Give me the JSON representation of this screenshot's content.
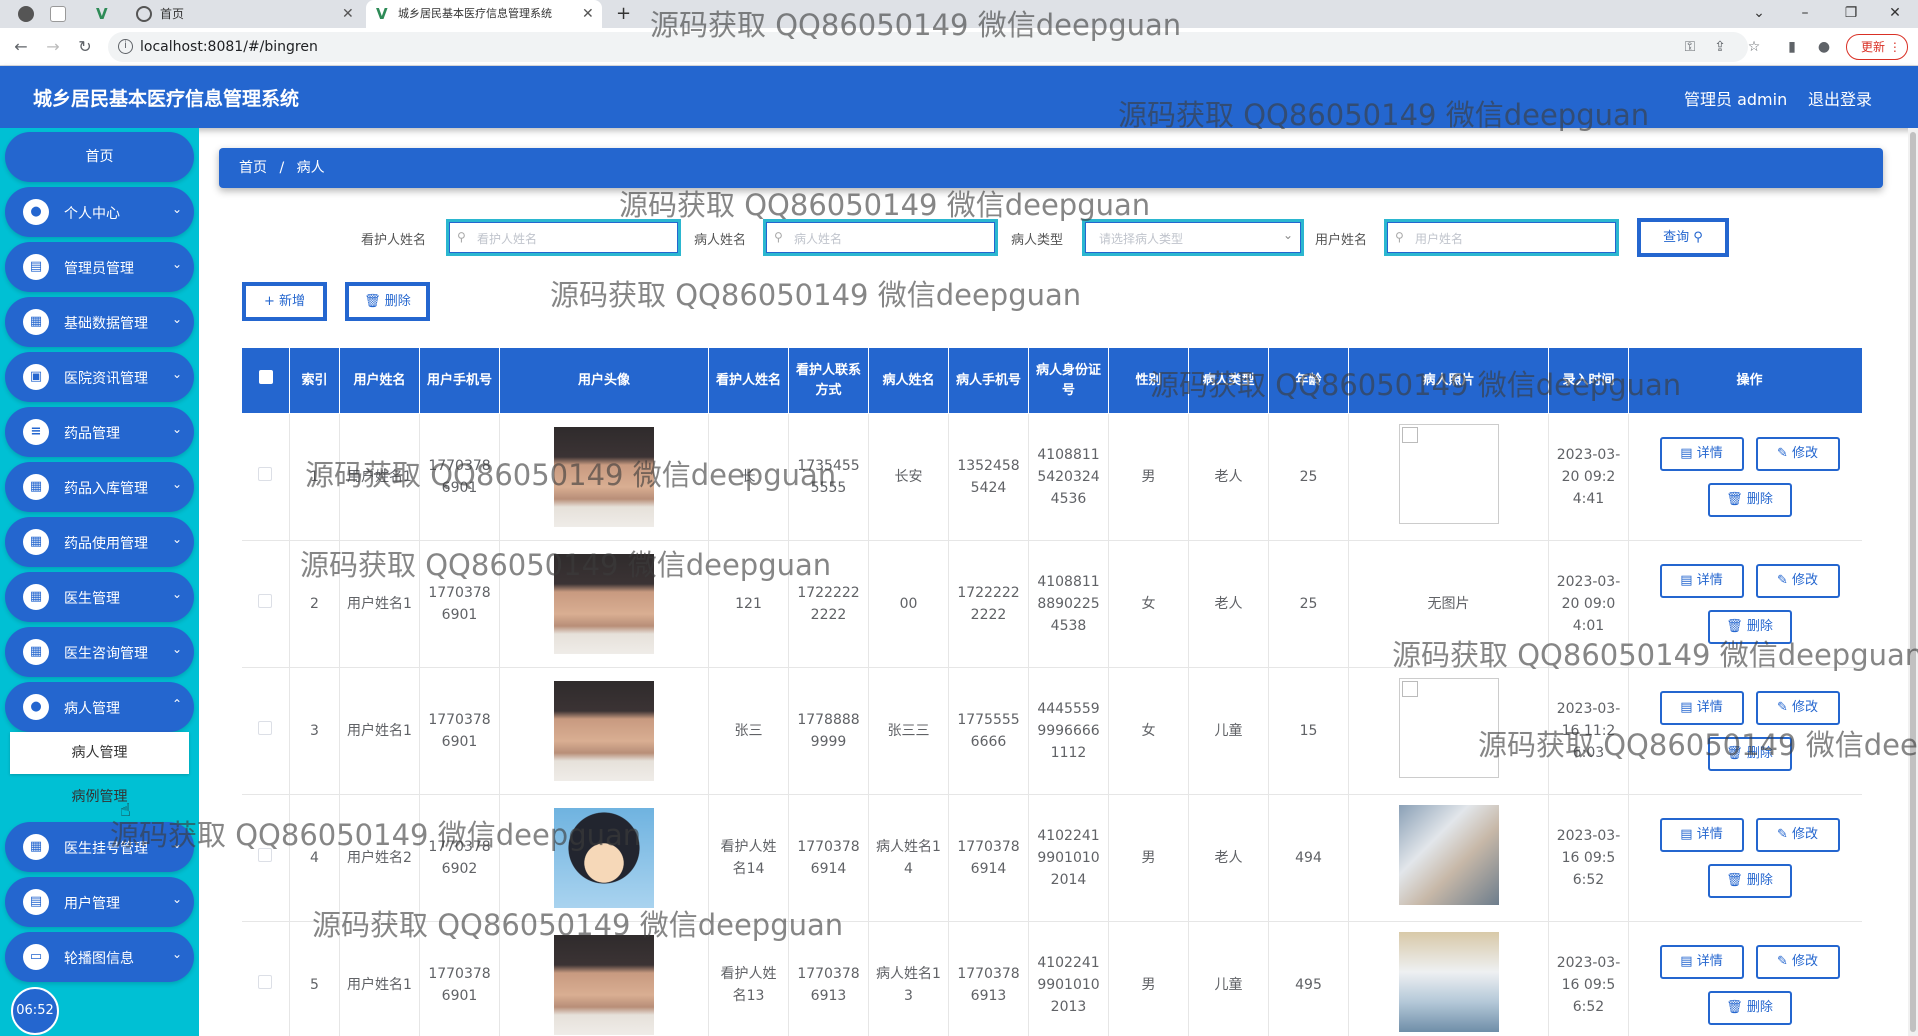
{
  "browser": {
    "tabs": [
      {
        "title": "首页"
      },
      {
        "title": "城乡居民基本医疗信息管理系统"
      }
    ],
    "new_tab": "+",
    "url": "localhost:8081/#/bingren",
    "update_label": "更新"
  },
  "header": {
    "title": "城乡居民基本医疗信息管理系统",
    "admin": "管理员 admin",
    "logout": "退出登录"
  },
  "sidebar": {
    "home": "首页",
    "items": [
      {
        "label": "个人中心",
        "icon": "person-icon"
      },
      {
        "label": "管理员管理",
        "icon": "clipboard-icon"
      },
      {
        "label": "基础数据管理",
        "icon": "grid-icon"
      },
      {
        "label": "医院资讯管理",
        "icon": "news-icon"
      },
      {
        "label": "药品管理",
        "icon": "list-icon"
      },
      {
        "label": "药品入库管理",
        "icon": "grid-icon"
      },
      {
        "label": "药品使用管理",
        "icon": "grid-icon"
      },
      {
        "label": "医生管理",
        "icon": "grid-icon"
      },
      {
        "label": "医生咨询管理",
        "icon": "grid-icon"
      },
      {
        "label": "病人管理",
        "icon": "person-icon"
      }
    ],
    "sub_items": [
      "病人管理",
      "病例管理"
    ],
    "items_after": [
      {
        "label": "医生挂号管理",
        "icon": "grid-icon"
      },
      {
        "label": "用户管理",
        "icon": "clipboard-icon"
      },
      {
        "label": "轮播图信息",
        "icon": "carousel-icon"
      }
    ],
    "clock": "06:52"
  },
  "breadcrumb": {
    "home": "首页",
    "sep": "/",
    "current": "病人"
  },
  "search": {
    "fields": [
      {
        "label": "看护人姓名",
        "placeholder": "看护人姓名"
      },
      {
        "label": "病人姓名",
        "placeholder": "病人姓名"
      },
      {
        "label": "病人类型",
        "placeholder": "请选择病人类型"
      },
      {
        "label": "用户姓名",
        "placeholder": "用户姓名"
      }
    ],
    "query": "查询 ⚲"
  },
  "actions": {
    "add": "+ 新增",
    "delete": "🗑 删除"
  },
  "table": {
    "headers": [
      "索引",
      "用户姓名",
      "用户手机号",
      "用户头像",
      "看护人姓名",
      "看护人联系方式",
      "病人姓名",
      "病人手机号",
      "病人身份证号",
      "性别",
      "病人类型",
      "年龄",
      "病人照片",
      "录入时间",
      "操作"
    ],
    "rows": [
      {
        "index": "1",
        "user": "用户姓名1",
        "phone": "17703786901",
        "avatar": "boy",
        "guardian": "长",
        "guardian_phone": "17354555555",
        "patient": "长安",
        "patient_phone": "13524585424",
        "id_card": "410881154203244536",
        "sex": "男",
        "type": "老人",
        "age": "25",
        "photo": "broken",
        "time": "2023-03-20 09:24:41"
      },
      {
        "index": "2",
        "user": "用户姓名1",
        "phone": "17703786901",
        "avatar": "boy",
        "guardian": "121",
        "guardian_phone": "17222222222",
        "patient": "00",
        "patient_phone": "17222222222",
        "id_card": "410881188902254538",
        "sex": "女",
        "type": "老人",
        "age": "25",
        "photo": "none",
        "photo_text": "无图片",
        "time": "2023-03-20 09:04:01"
      },
      {
        "index": "3",
        "user": "用户姓名1",
        "phone": "17703786901",
        "avatar": "boy",
        "guardian": "张三",
        "guardian_phone": "17788889999",
        "patient": "张三三",
        "patient_phone": "17755556666",
        "id_card": "444555999966661112",
        "sex": "女",
        "type": "儿童",
        "age": "15",
        "photo": "broken",
        "time": "2023-03-16 11:26:03"
      },
      {
        "index": "4",
        "user": "用户姓名2",
        "phone": "17703786902",
        "avatar": "conan",
        "guardian": "看护人姓名14",
        "guardian_phone": "17703786914",
        "patient": "病人姓名14",
        "patient_phone": "17703786914",
        "id_card": "410224199010102014",
        "sex": "男",
        "type": "老人",
        "age": "494",
        "photo": "photo1",
        "time": "2023-03-16 09:56:52"
      },
      {
        "index": "5",
        "user": "用户姓名1",
        "phone": "17703786901",
        "avatar": "boy",
        "guardian": "看护人姓名13",
        "guardian_phone": "17703786913",
        "patient": "病人姓名13",
        "patient_phone": "17703786913",
        "id_card": "410224199010102013",
        "sex": "男",
        "type": "儿童",
        "age": "495",
        "photo": "photo2",
        "time": "2023-03-16 09:56:52"
      }
    ],
    "op": {
      "detail": "详情",
      "edit": "修改",
      "delete": "删除"
    }
  },
  "watermark": "源码获取 QQ86050149 微信deepguan"
}
